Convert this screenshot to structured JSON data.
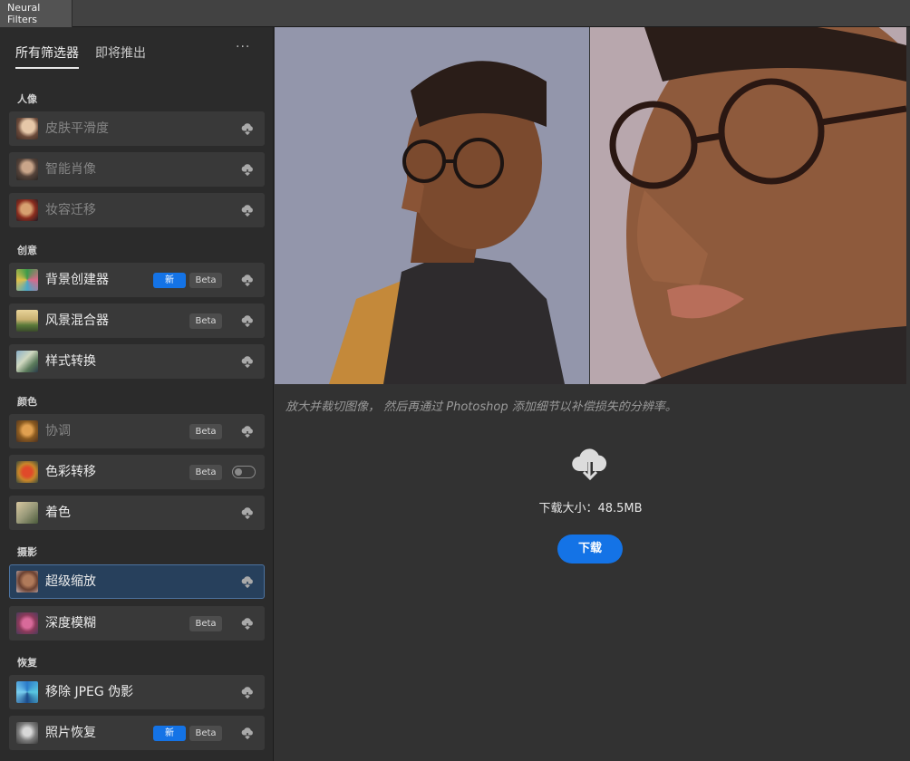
{
  "window": {
    "tab_title": "Neural Filters"
  },
  "sidebar": {
    "tabs": [
      "所有筛选器",
      "即将推出"
    ],
    "more_label": "···",
    "categories": [
      {
        "label": "人像",
        "items": [
          {
            "label": "皮肤平滑度",
            "state": "download"
          },
          {
            "label": "智能肖像",
            "state": "download"
          },
          {
            "label": "妆容迁移",
            "state": "download"
          }
        ]
      },
      {
        "label": "创意",
        "items": [
          {
            "label": "背景创建器",
            "badges": [
              "新",
              "Beta"
            ]
          },
          {
            "label": "风景混合器",
            "badges": [
              "Beta"
            ]
          },
          {
            "label": "样式转换"
          }
        ]
      },
      {
        "label": "颜色",
        "items": [
          {
            "label": "协调",
            "badges": [
              "Beta"
            ]
          },
          {
            "label": "色彩转移",
            "badges": [
              "Beta"
            ],
            "control": "toggle"
          },
          {
            "label": "着色"
          }
        ]
      },
      {
        "label": "摄影",
        "items": [
          {
            "label": "超级缩放",
            "selected": true
          },
          {
            "label": "深度模糊",
            "badges": [
              "Beta"
            ]
          }
        ]
      },
      {
        "label": "恢复",
        "items": [
          {
            "label": "移除 JPEG 伪影"
          },
          {
            "label": "照片恢复",
            "badges": [
              "新",
              "Beta"
            ]
          }
        ]
      }
    ]
  },
  "main": {
    "description": "放大并裁切图像， 然后再通过 Photoshop 添加细节以补偿损失的分辨率。",
    "download_size": "下载大小：48.5MB",
    "download_button": "下载"
  },
  "colors": {
    "accent": "#1473e6",
    "selected_bg": "#27405c",
    "panel_bg": "#2b2b2b",
    "main_bg": "#323232"
  }
}
